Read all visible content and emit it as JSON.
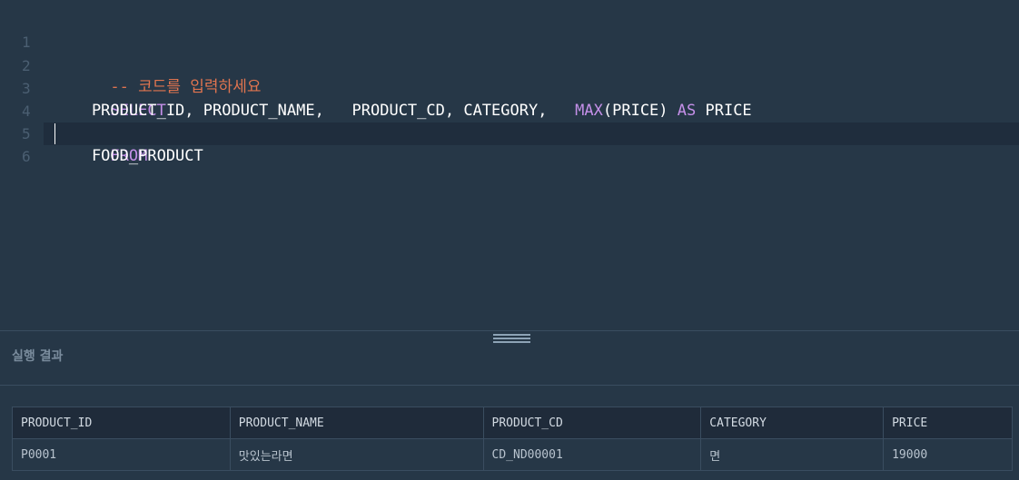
{
  "editor": {
    "lines": [
      {
        "number": "1",
        "tokens": [
          {
            "type": "comment",
            "text": "-- 코드를 입력하세요"
          }
        ]
      },
      {
        "number": "2",
        "tokens": [
          {
            "type": "keyword",
            "text": "SELECT"
          }
        ]
      },
      {
        "number": "3",
        "tokens": [
          {
            "type": "plain",
            "text": "    PRODUCT_ID, PRODUCT_NAME,   PRODUCT_CD, CATEGORY,   "
          },
          {
            "type": "keyword",
            "text": "MAX"
          },
          {
            "type": "plain",
            "text": "(PRICE) "
          },
          {
            "type": "keyword",
            "text": "AS"
          },
          {
            "type": "plain",
            "text": " PRICE"
          }
        ]
      },
      {
        "number": "4",
        "tokens": [
          {
            "type": "keyword",
            "text": "FROM"
          }
        ]
      },
      {
        "number": "5",
        "tokens": [
          {
            "type": "plain",
            "text": "    FOOD_PRODUCT"
          }
        ]
      },
      {
        "number": "6",
        "tokens": []
      }
    ],
    "active_line": 6
  },
  "result": {
    "title": "실행 결과",
    "columns": [
      "PRODUCT_ID",
      "PRODUCT_NAME",
      "PRODUCT_CD",
      "CATEGORY",
      "PRICE"
    ],
    "rows": [
      [
        "P0001",
        "맛있는라면",
        "CD_ND00001",
        "면",
        "19000"
      ]
    ]
  },
  "colors": {
    "background": "#263747",
    "comment": "#e0744f",
    "keyword": "#c590e9",
    "line_number": "#4b5f72"
  }
}
